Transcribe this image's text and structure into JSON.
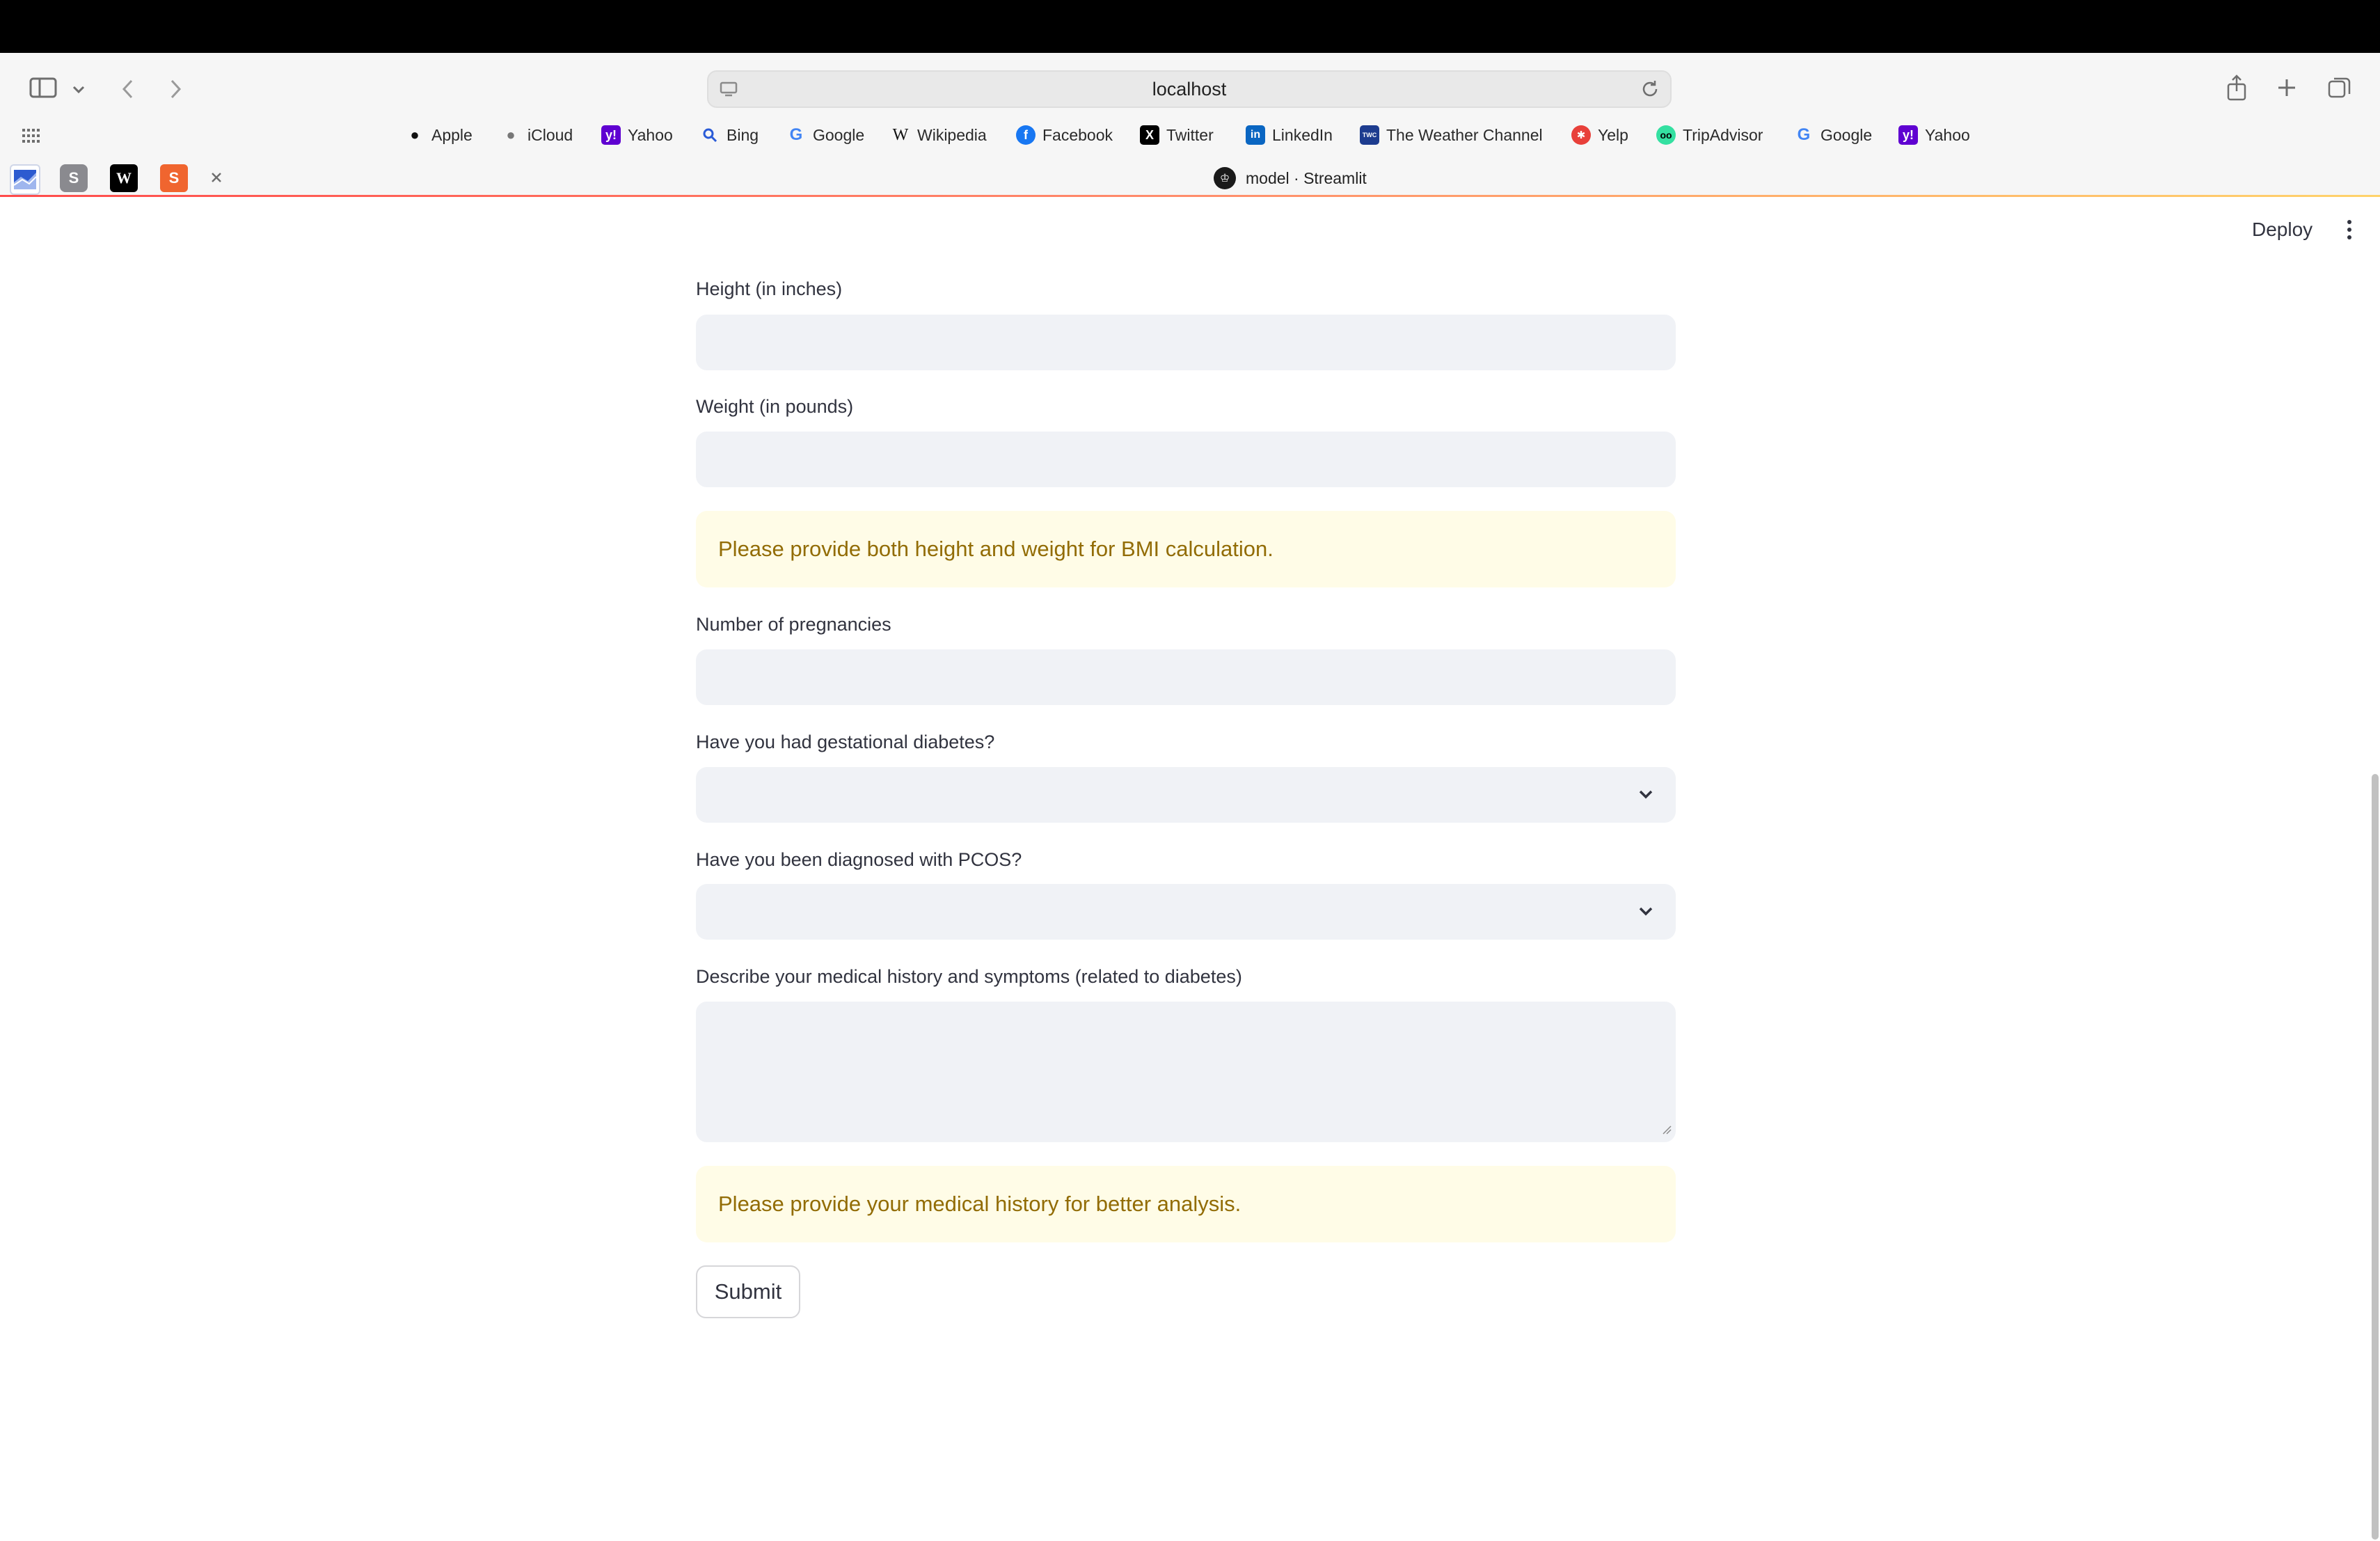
{
  "browser": {
    "url": "localhost",
    "bookmarks": [
      {
        "label": "Apple",
        "icon": "apple-icon"
      },
      {
        "label": "iCloud",
        "icon": "apple-icon"
      },
      {
        "label": "Yahoo",
        "icon": "yahoo-icon"
      },
      {
        "label": "Bing",
        "icon": "search-icon"
      },
      {
        "label": "Google",
        "icon": "google-icon"
      },
      {
        "label": "Wikipedia",
        "icon": "wikipedia-icon"
      },
      {
        "label": "Facebook",
        "icon": "facebook-icon"
      },
      {
        "label": "Twitter",
        "icon": "x-icon"
      },
      {
        "label": "LinkedIn",
        "icon": "linkedin-icon"
      },
      {
        "label": "The Weather Channel",
        "icon": "weather-channel-icon"
      },
      {
        "label": "Yelp",
        "icon": "yelp-icon"
      },
      {
        "label": "TripAdvisor",
        "icon": "tripadvisor-icon"
      },
      {
        "label": "Google",
        "icon": "google-icon"
      },
      {
        "label": "Yahoo",
        "icon": "yahoo-icon"
      }
    ],
    "tabs": {
      "pinned": [
        {
          "icon": "chart-tab-icon"
        },
        {
          "icon": "s-tab-icon",
          "glyph": "S"
        },
        {
          "icon": "w-tab-icon",
          "glyph": "W"
        },
        {
          "icon": "sublime-tab-icon",
          "glyph": "S"
        }
      ],
      "active_title": "model · Streamlit"
    }
  },
  "app": {
    "deploy_label": "Deploy",
    "form": {
      "height_label": "Height (in inches)",
      "height_value": "",
      "weight_label": "Weight (in pounds)",
      "weight_value": "",
      "bmi_warning": "Please provide both height and weight for BMI calculation.",
      "pregnancies_label": "Number of pregnancies",
      "pregnancies_value": "",
      "gestational_label": "Have you had gestational diabetes?",
      "gestational_value": "",
      "pcos_label": "Have you been diagnosed with PCOS?",
      "pcos_value": "",
      "history_label": "Describe your medical history and symptoms (related to diabetes)",
      "history_value": "",
      "history_warning": "Please provide your medical history for better analysis.",
      "submit_label": "Submit"
    }
  },
  "colors": {
    "input_bg": "#f0f2f6",
    "warning_bg": "#fffce7",
    "warning_text": "#926c05",
    "text": "#31333f"
  }
}
